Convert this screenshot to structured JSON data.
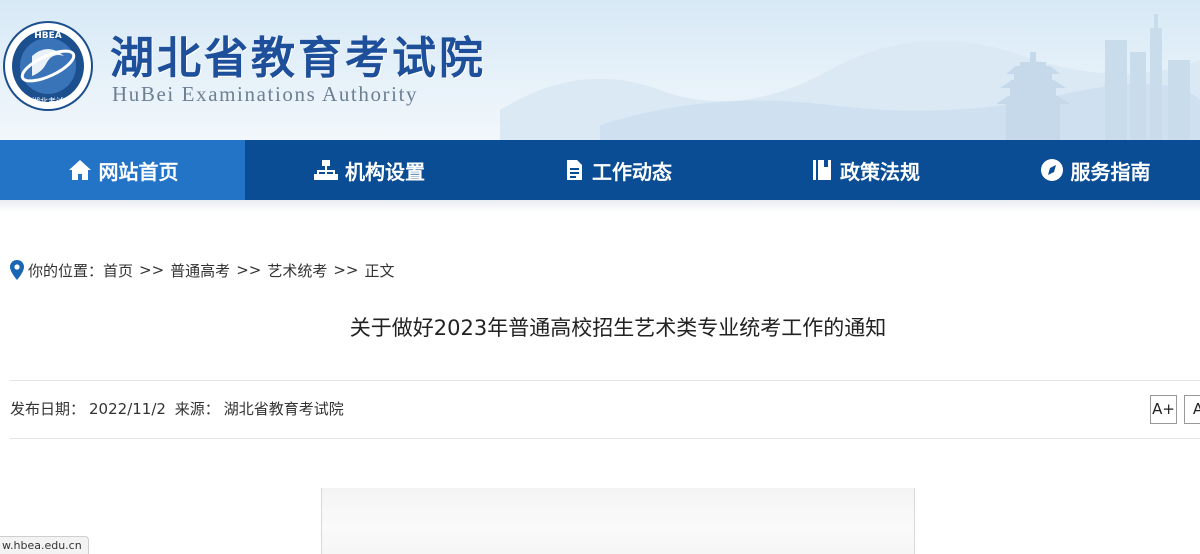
{
  "header": {
    "logo_text": "HBEA",
    "logo_ring_text": "湖北考试",
    "title": "湖北省教育考试院",
    "subtitle": "HuBei Examinations Authority"
  },
  "nav": {
    "items": [
      {
        "label": "网站首页",
        "icon": "home-icon"
      },
      {
        "label": "机构设置",
        "icon": "sitemap-icon"
      },
      {
        "label": "工作动态",
        "icon": "document-icon"
      },
      {
        "label": "政策法规",
        "icon": "book-icon"
      },
      {
        "label": "服务指南",
        "icon": "compass-icon"
      }
    ]
  },
  "breadcrumb": {
    "prefix": "你的位置：",
    "separator": ">>",
    "items": [
      "首页",
      "普通高考",
      "艺术统考",
      "正文"
    ]
  },
  "article": {
    "title": "关于做好2023年普通高校招生艺术类专业统考工作的通知",
    "date_label": "发布日期：",
    "date": "2022/11/2",
    "source_label": "来源：",
    "source": "湖北省教育考试院",
    "font_increase": "A+",
    "font_decrease": "A"
  },
  "status_bar": {
    "url": "w.hbea.edu.cn"
  },
  "colors": {
    "nav_bg": "#0a4d94",
    "nav_active": "#2373c7",
    "title_blue": "#1d4f9a"
  }
}
